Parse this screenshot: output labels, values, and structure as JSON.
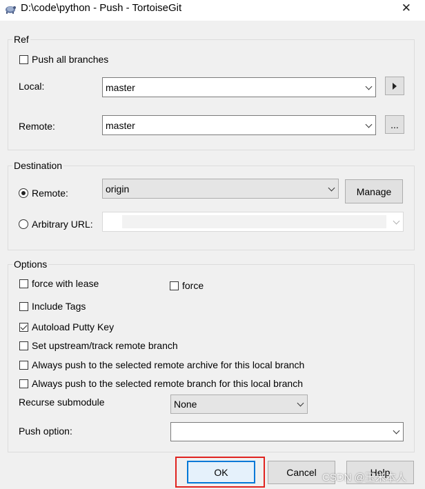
{
  "window": {
    "title": "D:\\code\\python - Push - TortoiseGit",
    "close_glyph": "✕",
    "icon": "tortoisegit-icon"
  },
  "ref": {
    "label": "Ref",
    "push_all_branches": {
      "label": "Push all branches",
      "checked": false
    },
    "local": {
      "label": "Local:",
      "value": "master"
    },
    "remote": {
      "label": "Remote:",
      "value": "master"
    },
    "browse_label": "..."
  },
  "destination": {
    "label": "Destination",
    "remote": {
      "label": "Remote:",
      "selected": true,
      "value": "origin"
    },
    "manage_label": "Manage",
    "arbitrary_url": {
      "label": "Arbitrary URL:",
      "selected": false,
      "value": ""
    }
  },
  "options": {
    "label": "Options",
    "force_with_lease": {
      "label": "force with lease",
      "checked": false
    },
    "force": {
      "label": "force",
      "checked": false
    },
    "include_tags": {
      "label": "Include Tags",
      "checked": false
    },
    "autoload_putty_key": {
      "label": "Autoload Putty Key",
      "checked": true
    },
    "set_upstream": {
      "label": "Set upstream/track remote branch",
      "checked": false
    },
    "always_push_archive": {
      "label": "Always push to the selected remote archive for this local branch",
      "checked": false
    },
    "always_push_branch": {
      "label": "Always push to the selected remote branch for this local branch",
      "checked": false
    },
    "recurse_submodule": {
      "label": "Recurse submodule",
      "value": "None"
    },
    "push_option": {
      "label": "Push option:",
      "value": ""
    }
  },
  "buttons": {
    "ok": "OK",
    "cancel": "Cancel",
    "help": "Help"
  },
  "watermark": "CSDN @玉米本人",
  "colors": {
    "accent": "#0078d7",
    "highlight": "#e0221e",
    "background": "#f0f0f0"
  }
}
